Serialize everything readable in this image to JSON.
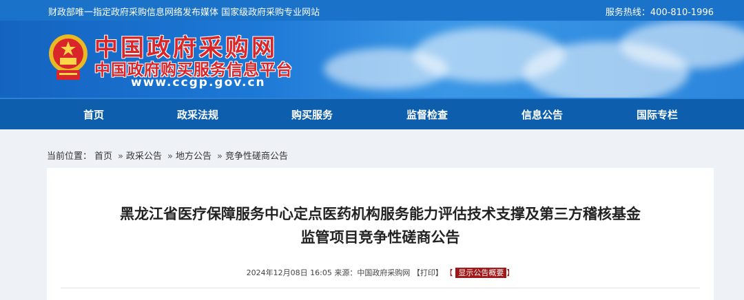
{
  "topbar": {
    "left_text": "财政部唯一指定政府采购信息网络发布媒体 国家级政府采购专业网站",
    "hotline": "服务热线：400-810-1996"
  },
  "banner": {
    "title": "中国政府采购网",
    "subtitle": "中国政府购买服务信息平台",
    "url": "www.ccgp.gov.cn"
  },
  "nav": {
    "items": [
      "首页",
      "政采法规",
      "购买服务",
      "监督检查",
      "信息公告",
      "国际专栏"
    ]
  },
  "breadcrumb": {
    "prefix": "当前位置：",
    "items": [
      "首页",
      "政采公告",
      "地方公告",
      "竞争性磋商公告"
    ],
    "separator": "»"
  },
  "article": {
    "title_line1": "黑龙江省医疗保障服务中心定点医药机构服务能力评估技术支撑及第三方稽核基金",
    "title_line2": "监管项目竞争性磋商公告",
    "date": "2024年12月08日 16:05",
    "source": "来源：中国政府采购网",
    "print": "【打印】",
    "summary_button": "显示公告概要"
  },
  "colors": {
    "topbar": "#1a72c9",
    "nav": "#0d5fae",
    "logo_red": "#d8262b",
    "badge": "#a01818"
  }
}
